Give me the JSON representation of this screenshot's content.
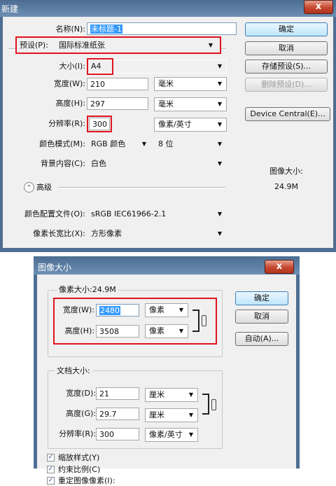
{
  "new_dialog": {
    "title": "新建",
    "name_label": "名称(N):",
    "name_value": "未标题-1",
    "preset_label": "预设(P):",
    "preset_value": "国际标准纸张",
    "size_label": "大小(I):",
    "size_value": "A4",
    "width_label": "宽度(W):",
    "width_value": "210",
    "width_unit": "毫米",
    "height_label": "高度(H):",
    "height_value": "297",
    "height_unit": "毫米",
    "resolution_label": "分辨率(R):",
    "resolution_value": "300",
    "resolution_unit": "像素/英寸",
    "color_mode_label": "颜色模式(M):",
    "color_mode_value": "RGB 颜色",
    "bit_depth_value": "8 位",
    "background_label": "背景内容(C):",
    "background_value": "白色",
    "advanced_label": "高级",
    "color_profile_label": "颜色配置文件(O):",
    "color_profile_value": "sRGB IEC61966-2.1",
    "pixel_aspect_label": "像素长宽比(X):",
    "pixel_aspect_value": "方形像素",
    "buttons": {
      "ok": "确定",
      "cancel": "取消",
      "save_preset": "存储预设(S)...",
      "delete_preset": "删除预设(D)...",
      "device_central": "Device Central(E)..."
    },
    "image_size_label": "图像大小:",
    "image_size_value": "24.9M",
    "close_glyph": "x"
  },
  "image_size_dialog": {
    "title": "图像大小",
    "pixel_dimensions_legend": "像素大小:24.9M",
    "pixel_width_label": "宽度(W):",
    "pixel_width_value": "2480",
    "pixel_width_unit": "像素",
    "pixel_height_label": "高度(H):",
    "pixel_height_value": "3508",
    "pixel_height_unit": "像素",
    "document_size_legend": "文档大小:",
    "doc_width_label": "宽度(D):",
    "doc_width_value": "21",
    "doc_width_unit": "厘米",
    "doc_height_label": "高度(G):",
    "doc_height_value": "29.7",
    "doc_height_unit": "厘米",
    "doc_resolution_label": "分辨率(R):",
    "doc_resolution_value": "300",
    "doc_resolution_unit": "像素/英寸",
    "scale_styles_label": "缩放样式(Y)",
    "constrain_proportions_label": "约束比例(C)",
    "resample_label": "重定图像像素(I):",
    "buttons": {
      "ok": "确定",
      "cancel": "取消",
      "auto": "自动(A)..."
    },
    "close_glyph": "x"
  }
}
